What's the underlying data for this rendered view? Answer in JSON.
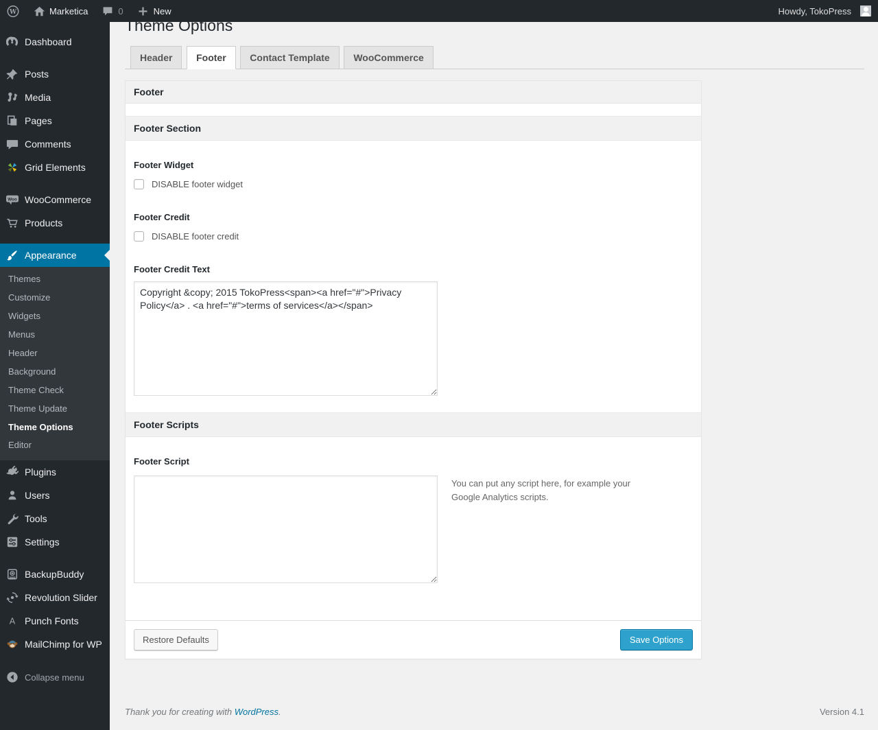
{
  "admin_bar": {
    "site_name": "Marketica",
    "comment_count": "0",
    "new_label": "New",
    "howdy": "Howdy, TokoPress"
  },
  "sidebar": {
    "items": [
      {
        "label": "Dashboard"
      },
      {
        "label": "Posts"
      },
      {
        "label": "Media"
      },
      {
        "label": "Pages"
      },
      {
        "label": "Comments"
      },
      {
        "label": "Grid Elements"
      },
      {
        "label": "WooCommerce"
      },
      {
        "label": "Products"
      },
      {
        "label": "Appearance"
      },
      {
        "label": "Plugins"
      },
      {
        "label": "Users"
      },
      {
        "label": "Tools"
      },
      {
        "label": "Settings"
      },
      {
        "label": "BackupBuddy"
      },
      {
        "label": "Revolution Slider"
      },
      {
        "label": "Punch Fonts"
      },
      {
        "label": "MailChimp for WP"
      }
    ],
    "appearance_submenu": [
      {
        "label": "Themes"
      },
      {
        "label": "Customize"
      },
      {
        "label": "Widgets"
      },
      {
        "label": "Menus"
      },
      {
        "label": "Header"
      },
      {
        "label": "Background"
      },
      {
        "label": "Theme Check"
      },
      {
        "label": "Theme Update"
      },
      {
        "label": "Theme Options"
      },
      {
        "label": "Editor"
      }
    ],
    "collapse_label": "Collapse menu"
  },
  "page": {
    "title": "Theme Options",
    "tabs": [
      {
        "label": "Header"
      },
      {
        "label": "Footer"
      },
      {
        "label": "Contact Template"
      },
      {
        "label": "WooCommerce"
      }
    ],
    "panel_title": "Footer",
    "footer_section_title": "Footer Section",
    "footer_widget_label": "Footer Widget",
    "footer_widget_checkbox": "DISABLE footer widget",
    "footer_credit_label": "Footer Credit",
    "footer_credit_checkbox": "DISABLE footer credit",
    "footer_credit_text_label": "Footer Credit Text",
    "footer_credit_text_value": "Copyright &copy; 2015 TokoPress<span><a href=\"#\">Privacy Policy</a> . <a href=\"#\">terms of services</a></span>",
    "footer_scripts_title": "Footer Scripts",
    "footer_script_label": "Footer Script",
    "footer_script_value": "",
    "footer_script_help": "You can put any script here, for example your Google Analytics scripts.",
    "restore_button": "Restore Defaults",
    "save_button": "Save Options"
  },
  "footer": {
    "thanks_prefix": "Thank you for creating with ",
    "thanks_link": "WordPress",
    "thanks_suffix": ".",
    "version": "Version 4.1"
  },
  "colors": {
    "accent": "#0074a2",
    "primary_button": "#2ea2cc",
    "admin_bar_bg": "#23282d",
    "submenu_bg": "#32373c",
    "page_bg": "#f1f1f1"
  }
}
